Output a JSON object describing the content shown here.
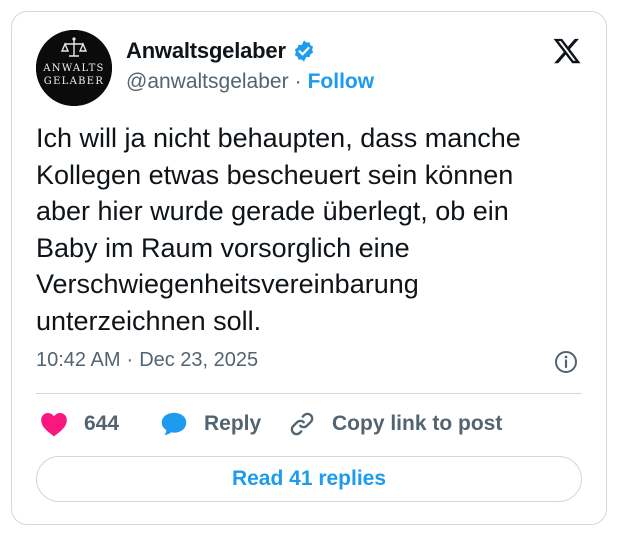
{
  "author": {
    "display_name": "Anwaltsgelaber",
    "handle": "@anwaltsgelaber",
    "follow_label": "Follow",
    "verified": true,
    "avatar_text_line1": "ANWALTS",
    "avatar_text_line2": "GELABER"
  },
  "tweet": {
    "text": "Ich will ja nicht behaupten, dass manche\nKollegen etwas bescheuert sein können\naber hier wurde gerade überlegt, ob ein\nBaby im Raum vorsorglich eine\nVerschwiegenheitsvereinbarung\nunterzeichnen soll.",
    "time": "10:42 AM",
    "date": "Dec 23, 2025"
  },
  "actions": {
    "likes": "644",
    "reply_label": "Reply",
    "copy_link_label": "Copy link to post"
  },
  "read_replies_label": "Read 41 replies",
  "colors": {
    "accent": "#1d9bf0",
    "like": "#f91880",
    "text": "#0f1419",
    "muted": "#536471",
    "border": "#cfd9de"
  },
  "icons": {
    "logo": "x-logo-icon",
    "verified": "verified-badge-icon",
    "info": "info-icon",
    "like": "heart-icon",
    "reply": "speech-bubble-icon",
    "link": "link-icon"
  }
}
